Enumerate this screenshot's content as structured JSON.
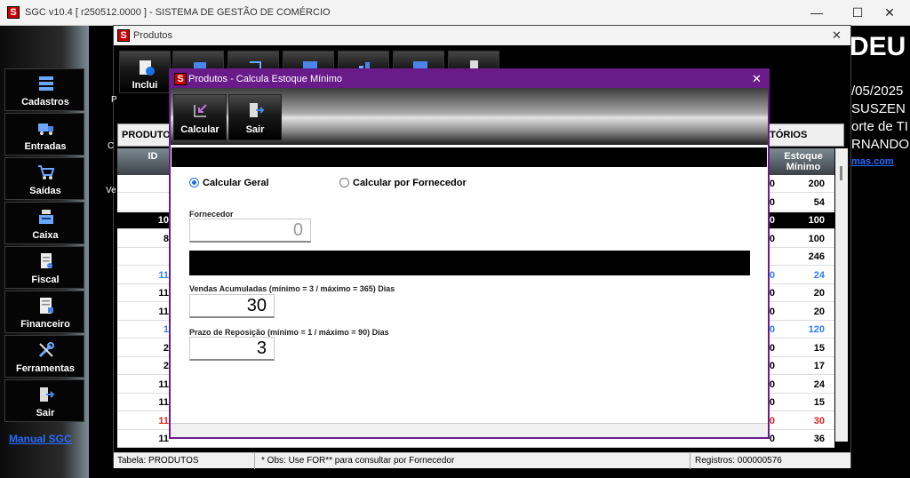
{
  "main_window": {
    "logo": "S",
    "title": "SGC v10.4 [ r250512.0000 ] - SISTEMA DE GESTÃO DE COMÉRCIO",
    "minimize": "—",
    "maximize": "☐",
    "close": "✕"
  },
  "sidebar": {
    "items": [
      {
        "label": "Cadastros",
        "icon": "database-icon"
      },
      {
        "label": "Entradas",
        "icon": "truck-icon"
      },
      {
        "label": "Saídas",
        "icon": "cart-icon"
      },
      {
        "label": "Caixa",
        "icon": "cash-register-icon"
      },
      {
        "label": "Fiscal",
        "icon": "document-icon"
      },
      {
        "label": "Financeiro",
        "icon": "ledger-icon"
      },
      {
        "label": "Ferramentas",
        "icon": "tools-icon"
      },
      {
        "label": "Sair",
        "icon": "exit-door-icon"
      }
    ],
    "manual_link": "Manual SGC"
  },
  "background_info": {
    "brand": "DEU",
    "date": "/05/2025",
    "user": "SUSZEN",
    "support": "orte de TI",
    "name": "RNANDO",
    "link": "mas.com"
  },
  "produtos_window": {
    "logo": "S",
    "title": "Produtos",
    "close": "✕",
    "toolbar": [
      {
        "label": "Inclui",
        "icon": "add-document-icon"
      },
      {
        "label": "",
        "icon": "edit-icon"
      },
      {
        "label": "",
        "icon": "export-icon"
      },
      {
        "label": "",
        "icon": "calendar-icon"
      },
      {
        "label": "",
        "icon": "chart-icon"
      },
      {
        "label": "",
        "icon": "gauge-icon"
      },
      {
        "label": "",
        "icon": "exit-icon"
      }
    ],
    "tabs": {
      "left": "PRODUTO",
      "right": "ATÓRIOS"
    },
    "side_letters": [
      "P",
      "C",
      "Ve"
    ],
    "grid": {
      "col_id": "ID",
      "col_estoque": "Estoque Mínimo",
      "rows": [
        {
          "id": "",
          "p": "0",
          "estoque": "200",
          "color": "#000000",
          "selected": false
        },
        {
          "id": "",
          "p": "0",
          "estoque": "54",
          "color": "#000000",
          "selected": false
        },
        {
          "id": "10",
          "p": "0",
          "estoque": "100",
          "color": "#ffffff",
          "selected": true
        },
        {
          "id": "8",
          "p": "0",
          "estoque": "100",
          "color": "#000000",
          "selected": false
        },
        {
          "id": "",
          "p": "",
          "estoque": "246",
          "color": "#000000",
          "selected": false
        },
        {
          "id": "11",
          "p": "0",
          "estoque": "24",
          "color": "#2a7cff",
          "selected": false
        },
        {
          "id": "11",
          "p": "0",
          "estoque": "20",
          "color": "#000000",
          "selected": false
        },
        {
          "id": "11",
          "p": "0",
          "estoque": "20",
          "color": "#000000",
          "selected": false
        },
        {
          "id": "1",
          "p": "0",
          "estoque": "120",
          "color": "#2a7cff",
          "selected": false
        },
        {
          "id": "2",
          "p": "0",
          "estoque": "15",
          "color": "#000000",
          "selected": false
        },
        {
          "id": "2",
          "p": "0",
          "estoque": "17",
          "color": "#000000",
          "selected": false
        },
        {
          "id": "11",
          "p": "0",
          "estoque": "24",
          "color": "#000000",
          "selected": false
        },
        {
          "id": "11",
          "p": "0",
          "estoque": "15",
          "color": "#000000",
          "selected": false
        },
        {
          "id": "11",
          "p": "0",
          "estoque": "30",
          "color": "#e02020",
          "selected": false
        },
        {
          "id": "11",
          "p": "0",
          "estoque": "36",
          "color": "#000000",
          "selected": false
        }
      ]
    },
    "status": {
      "table": "Tabela: PRODUTOS",
      "obs": "* Obs: Use FOR** para consultar por Fornecedor",
      "registros": "Registros: 000000576"
    }
  },
  "dialog": {
    "logo": "S",
    "title": "Produtos - Calcula Estoque Mínimo",
    "close": "✕",
    "toolbar": [
      {
        "label": "Calcular",
        "icon": "calculate-icon"
      },
      {
        "label": "Sair",
        "icon": "exit-door-icon"
      }
    ],
    "radio_geral": "Calcular Geral",
    "radio_fornecedor": "Calcular por Fornecedor",
    "selected_option": "Calcular Geral",
    "fornecedor_label": "Fornecedor",
    "fornecedor_value": "0",
    "vendas_label": "Vendas Acumuladas (mínimo = 3 / máximo = 365) Dias",
    "vendas_value": "30",
    "prazo_label": "Prazo de Reposição (mínimo = 1 / máximo = 90) Dias",
    "prazo_value": "3"
  },
  "colors": {
    "dialog_accent": "#6a1b8a",
    "radio_selected": "#1a73e8",
    "link": "#2a6cff"
  }
}
